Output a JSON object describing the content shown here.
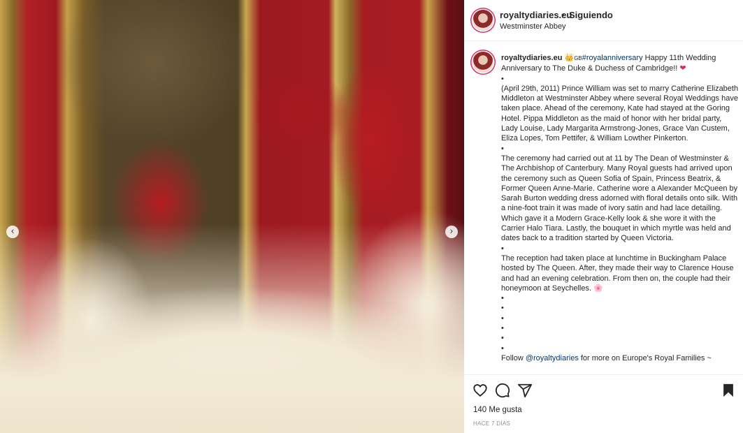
{
  "post": {
    "username": "royaltydiaries.eu",
    "separator": "•",
    "follow_label": "Siguiendo",
    "location": "Westminster Abbey"
  },
  "caption": {
    "username": "royaltydiaries.eu",
    "crown_emoji": "👑",
    "flag_text": "GB",
    "hashtag": "#royalanniversary",
    "intro": " Happy 11th Wedding Anniversary to The Duke & Duchess of Cambridge!! ",
    "heart_emoji": "❤",
    "dot": "•",
    "paragraph1": "(April 29th, 2011) Prince William was set to marry Catherine Elizabeth Middleton at Westminster Abbey where several Royal Weddings have taken place. Ahead of the ceremony, Kate had stayed at the Goring Hotel. Pippa Middleton as the maid of honor with her bridal party, Lady Louise, Lady Margarita Armstrong-Jones, Grace Van Custem, Eliza Lopes, Tom Pettifer, & William Lowther Pinkerton.",
    "paragraph2": "The ceremony had carried out at 11 by The Dean of Westminster & The Archbishop of Canterbury. Many Royal guests had arrived upon the ceremony such as Queen Sofia of Spain, Princess Beatrix, & Former Queen Anne-Marie. Catherine wore a Alexander McQueen by Sarah Burton wedding dress adorned with floral details onto silk. With a nine-foot train it was made of ivory satin and had lace detailing. Which gave it a Modern Grace-Kelly look & she wore it with the Carrier Halo Tiara. Lastly, the bouquet in which myrtle was held and dates back to a tradition started by Queen Victoria.",
    "paragraph3": "The reception had taken place at lunchtime in Buckingham Palace hosted by The Queen. After, they made their way to Clarence House and had an evening celebration. From then on, the couple had their honeymoon at Seychelles. ",
    "flower_emoji": "🌸",
    "follow_prefix": "Follow ",
    "follow_link": "@royaltydiaries",
    "follow_suffix": " for more on Europe's Royal Families ~"
  },
  "photo": {
    "prev_arrow": "‹",
    "next_arrow": "›"
  },
  "actions": {
    "likes": "140 Me gusta",
    "time": "HACE 7 DÍAS"
  },
  "colors": {
    "link": "#00376b",
    "story_ring": "#d9316e",
    "muted": "#8e8e8e"
  },
  "icons": [
    "heart-icon",
    "comment-icon",
    "share-icon",
    "bookmark-icon",
    "chevron-left-icon",
    "chevron-right-icon"
  ]
}
